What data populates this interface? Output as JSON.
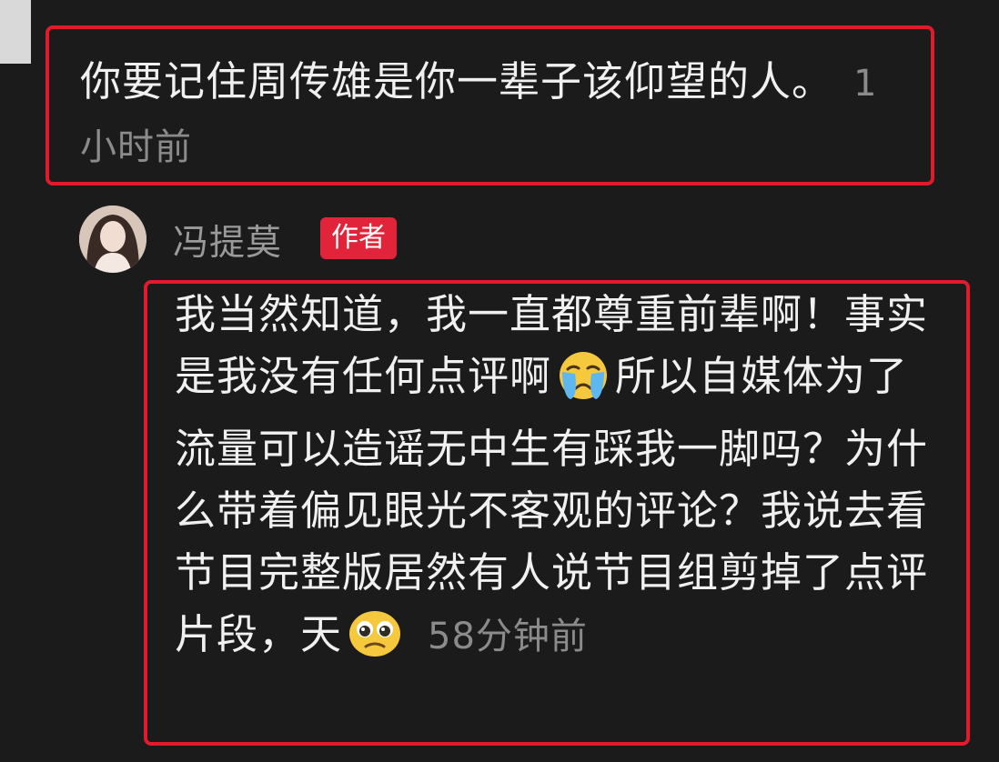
{
  "comment": {
    "text": "你要记住周传雄是你一辈子该仰望的人。",
    "time": "1小时前"
  },
  "reply": {
    "author": "冯提莫",
    "badge": "作者",
    "text_part1": "我当然知道，我一直都尊重前辈啊！事实是我没有任何点评啊",
    "emoji1": "crying-face-icon",
    "text_part2": "所以自媒体为了流量可以造谣无中生有踩我一脚吗？为什么带着偏见眼光不客观的评论？我说去看节目完整版居然有人说节目组剪掉了点评片段，天",
    "emoji2": "pleading-face-icon",
    "time": "58分钟前"
  },
  "colors": {
    "background": "#1b1b1c",
    "highlight_border": "#e11a2c",
    "badge": "#e2243b",
    "text": "#f0f0f0",
    "muted": "#8b8b8b"
  }
}
